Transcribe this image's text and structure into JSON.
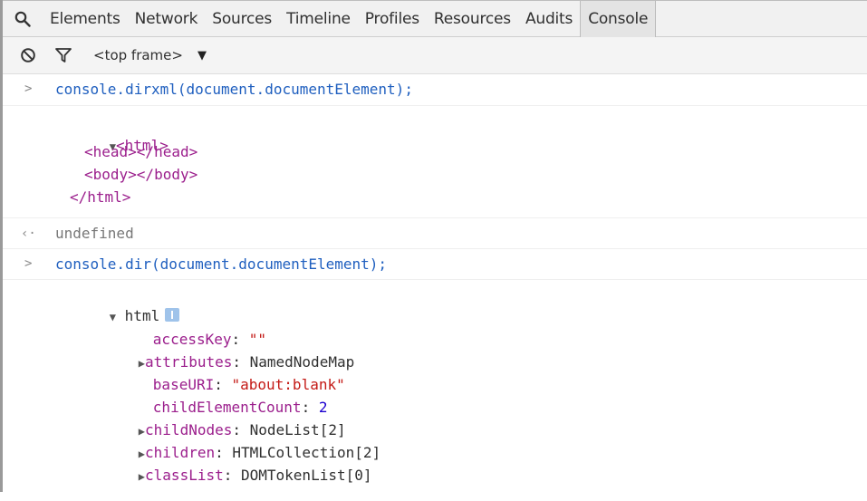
{
  "toolbar": {
    "tabs": [
      {
        "label": "Elements"
      },
      {
        "label": "Network"
      },
      {
        "label": "Sources"
      },
      {
        "label": "Timeline"
      },
      {
        "label": "Profiles"
      },
      {
        "label": "Resources"
      },
      {
        "label": "Audits"
      },
      {
        "label": "Console"
      }
    ],
    "active_tab": "Console",
    "search_icon": "search-icon"
  },
  "subbar": {
    "clear_icon": "clear-console-icon",
    "filter_icon": "filter-icon",
    "frame_select": "<top frame>",
    "frame_arrow": "▼"
  },
  "console": {
    "entry1": {
      "prompt": ">",
      "command": "console.dirxml(document.documentElement);",
      "tree": {
        "toggle": "▼",
        "open_html": "<html>",
        "head": "<head></head>",
        "body": "<body></body>",
        "close_html": "</html>"
      },
      "return_glyph": "‹·",
      "return_value": "undefined"
    },
    "entry2": {
      "prompt": ">",
      "command": "console.dir(document.documentElement);",
      "object": {
        "toggle": "▼",
        "name": "html",
        "properties": [
          {
            "expand": "",
            "key": "accessKey",
            "value": "\"\"",
            "type": "string"
          },
          {
            "expand": "▶",
            "key": "attributes",
            "value": "NamedNodeMap",
            "type": "object"
          },
          {
            "expand": "",
            "key": "baseURI",
            "value": "\"about:blank\"",
            "type": "string"
          },
          {
            "expand": "",
            "key": "childElementCount",
            "value": "2",
            "type": "number"
          },
          {
            "expand": "▶",
            "key": "childNodes",
            "value": "NodeList[2]",
            "type": "object"
          },
          {
            "expand": "▶",
            "key": "children",
            "value": "HTMLCollection[2]",
            "type": "object"
          },
          {
            "expand": "▶",
            "key": "classList",
            "value": "DOMTokenList[0]",
            "type": "object"
          }
        ]
      }
    }
  }
}
